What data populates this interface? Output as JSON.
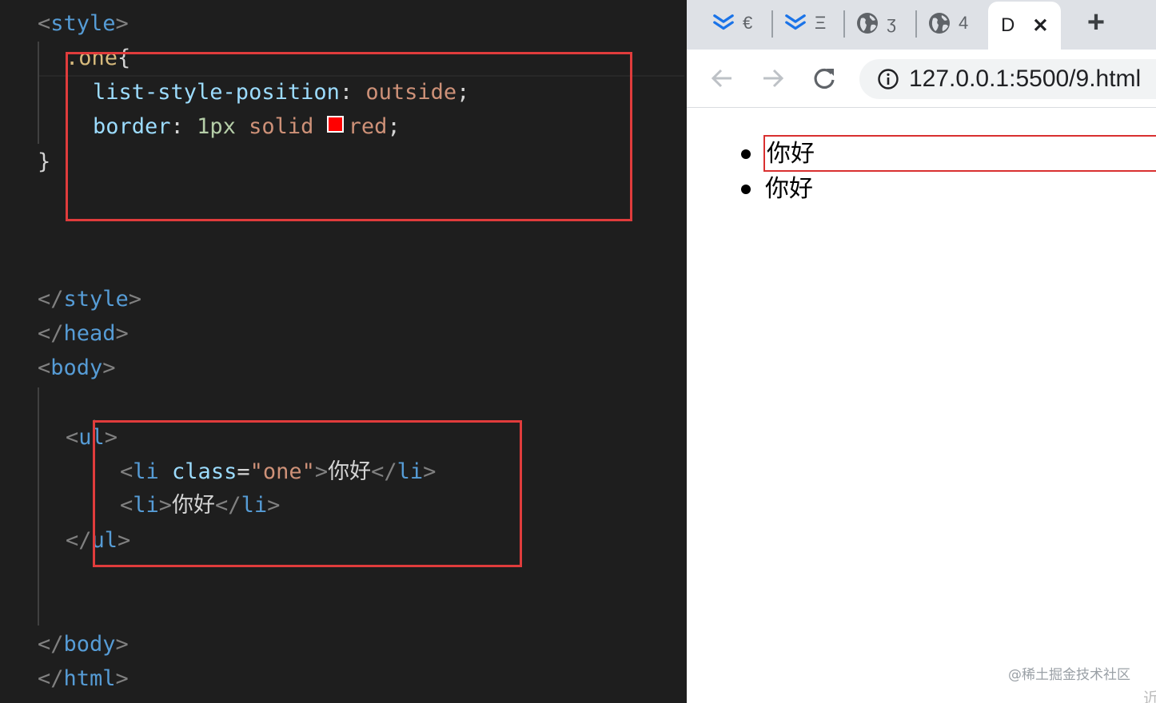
{
  "editor": {
    "lines": {
      "style_open": "style",
      "selector": ".one",
      "prop1_name": "list-style-position",
      "prop1_value": "outside",
      "prop2_name": "border",
      "prop2_num": "1px",
      "prop2_style": "solid",
      "prop2_color": "red",
      "close_brace": "}",
      "style_close": "style",
      "head_close": "head",
      "body_open": "body",
      "ul_open": "ul",
      "li1_tag": "li",
      "li1_attr": "class",
      "li1_value": "\"one\"",
      "li1_text": "你好",
      "li2_tag": "li",
      "li2_text": "你好",
      "ul_close": "ul",
      "body_close": "body",
      "html_close": "html"
    },
    "swatch_color": "#ff0000",
    "highlight_color": "#e03c3c"
  },
  "browser": {
    "tabs": [
      {
        "icon": "stack-icon",
        "label": "€"
      },
      {
        "icon": "stack-icon",
        "label": "Ξ"
      },
      {
        "icon": "globe-icon",
        "label": "ʒ"
      },
      {
        "icon": "globe-icon",
        "label": "4"
      }
    ],
    "active_tab": {
      "label": "D",
      "close": "✕"
    },
    "new_tab": "+",
    "url": "127.0.0.1:5500/9.html",
    "page": {
      "items": [
        "你好",
        "你好"
      ]
    },
    "watermark": "@稀土掘金技术社区",
    "corner_glyph": "近"
  }
}
